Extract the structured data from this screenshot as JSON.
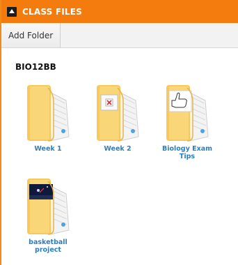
{
  "header": {
    "title": "CLASS FILES"
  },
  "toolbar": {
    "add_folder_label": "Add Folder"
  },
  "section": {
    "title": "BIO12BB"
  },
  "folders": [
    {
      "label": "Week 1",
      "thumbnail": "none"
    },
    {
      "label": "Week 2",
      "thumbnail": "broken-image-icon"
    },
    {
      "label": "Biology Exam Tips",
      "thumbnail": "thumbs-up-sketch"
    },
    {
      "label": "basketball project",
      "thumbnail": "dark-photo"
    }
  ],
  "colors": {
    "accent": "#f47c0f",
    "link": "#2a7fc1"
  }
}
